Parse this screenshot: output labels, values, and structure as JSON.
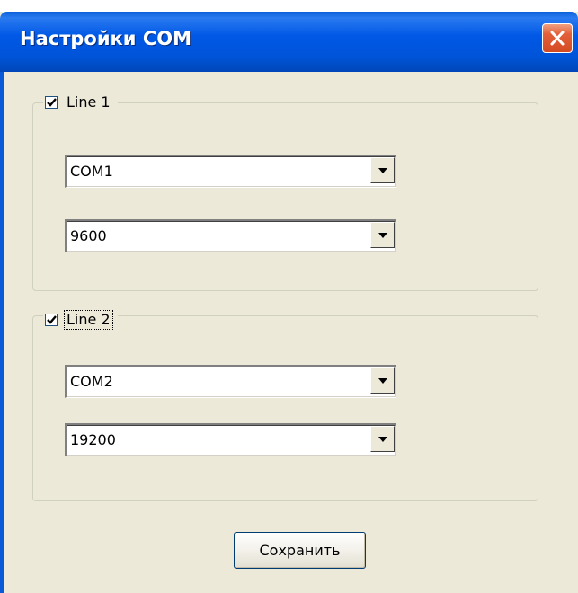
{
  "window": {
    "title": "Настройки COM"
  },
  "groups": [
    {
      "checkbox_label": "Line 1",
      "checked": true,
      "port": {
        "value": "COM1"
      },
      "baud": {
        "value": "9600"
      }
    },
    {
      "checkbox_label": "Line 2",
      "checked": true,
      "focused": true,
      "port": {
        "value": "COM2"
      },
      "baud": {
        "value": "19200"
      }
    }
  ],
  "actions": {
    "save_label": "Сохранить"
  },
  "icons": {
    "close": "close-icon",
    "check": "checkmark-icon",
    "dropdown": "dropdown-arrow-icon"
  },
  "colors": {
    "titlebar": "#0054e3",
    "dialog_bg": "#ece9d8",
    "close_button": "#e3603a"
  }
}
